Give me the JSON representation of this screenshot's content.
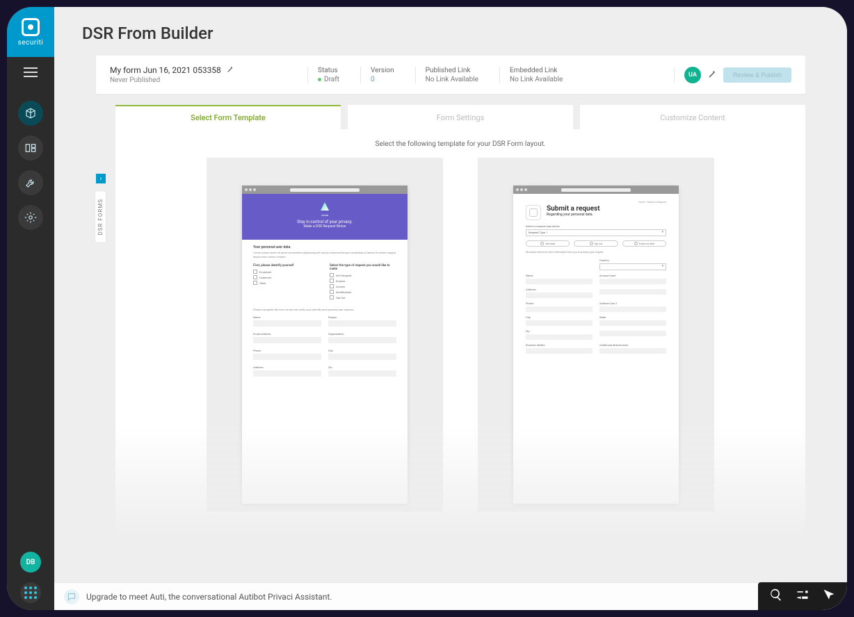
{
  "brand": {
    "name": "securiti"
  },
  "page": {
    "title": "DSR From Builder"
  },
  "sidebar_label": "DSR FORMS",
  "nav": {
    "user_initials": "DB"
  },
  "form_header": {
    "name": "My form Jun 16, 2021 053358",
    "subtitle": "Never Published",
    "status": {
      "label": "Status",
      "value": "Draft"
    },
    "version": {
      "label": "Version",
      "value": "0"
    },
    "published": {
      "label": "Published Link",
      "value": "No Link Available"
    },
    "embedded": {
      "label": "Embedded Link",
      "value": "No Link Available"
    },
    "user_badge": "UA",
    "review_btn": "Review & Publish"
  },
  "tabs": {
    "select_template": "Select Form Template",
    "form_settings": "Form Settings",
    "customize_content": "Customize Content"
  },
  "instruction": "Select the following template for your DSR Form layout.",
  "template_a": {
    "logo_name": "Avala",
    "headline": "Stay in control of your privacy.",
    "subhead": "Make a DSR Request Below",
    "section1_title": "Your personal user data.",
    "section1_desc": "Lorem ipsum dolor sit amet consectetur adipiscing elit sed do eiusmod tempor incididunt ut labore et dolore magna aliqua enim minim veniam.",
    "left_title": "First, please identify yourself",
    "left_items": [
      "Employee",
      "Customer",
      "Other"
    ],
    "right_title": "Select the type of request you would like to make",
    "right_items": [
      "Info Request",
      "Erasure",
      "Access",
      "Rectification",
      "Opt Out"
    ],
    "note": "Please complete the form so we can verify your identity and process your request.",
    "fields": [
      [
        "Name",
        "Region"
      ],
      [
        "Email Address",
        "Organization"
      ],
      [
        "Phone",
        "City"
      ],
      [
        "Address",
        "Zip"
      ]
    ]
  },
  "template_b": {
    "crumb": "Home / Submit a Request",
    "title": "Submit a request",
    "subtitle": "Regarding your personal data.",
    "select_label": "Select a request type below",
    "select_value": "Request Type 1",
    "chips": [
      "See data",
      "Opt out",
      "Erase my data"
    ],
    "hint": "We would need a bit more information from you to process your request.",
    "country_label": "Country",
    "rows": [
      [
        "Name",
        "Account type"
      ],
      [
        "Address",
        ""
      ],
      [
        "Phone",
        "Address line 2"
      ],
      [
        "City",
        "State"
      ],
      [
        "Zip",
        ""
      ],
      [
        "Request details",
        "Additional attachments"
      ]
    ]
  },
  "chatbar": {
    "text": "Upgrade to meet Auti, the conversational Autibot Privaci Assistant."
  }
}
